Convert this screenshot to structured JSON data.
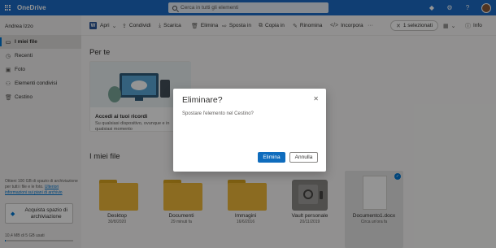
{
  "app": {
    "brand": "OneDrive"
  },
  "search": {
    "placeholder": "Cerca in tutti gli elementi"
  },
  "topbar_icons": [
    "diamond-icon",
    "gear-icon",
    "help-icon"
  ],
  "sidebar": {
    "user_name": "Andrea Izzo",
    "items": [
      {
        "label": "I miei file",
        "icon": "folder-icon",
        "active": true
      },
      {
        "label": "Recenti",
        "icon": "clock-icon"
      },
      {
        "label": "Foto",
        "icon": "photo-icon"
      },
      {
        "label": "Elementi condivisi",
        "icon": "people-icon"
      },
      {
        "label": "Cestino",
        "icon": "trash-icon"
      }
    ],
    "storage_note": "Ottieni 100 GB di spazio di archiviazione per tutti i file e le foto.",
    "storage_link": "Ulteriori informazioni sui piani di archivio",
    "buy_button": "Acquista spazio di archiviazione",
    "usage": "10,4 MB di 5 GB usati",
    "usage_fraction": 0.002
  },
  "toolbar": {
    "open": "Apri",
    "share": "Condividi",
    "download": "Scarica",
    "delete": "Elimina",
    "move": "Sposta in",
    "copy": "Copia in",
    "rename": "Rinomina",
    "embed": "Incorpora",
    "selected": "1 selezionati",
    "info": "Info"
  },
  "main": {
    "recent_title": "Per te",
    "recent_card_title": "Accedi ai tuoi ricordi",
    "recent_card_sub": "Su qualsiasi dispositivo, ovunque e in qualsiasi momento",
    "files_title": "I miei file",
    "files": [
      {
        "name": "Desktop",
        "date": "30/8/2020",
        "type": "folder",
        "count": ""
      },
      {
        "name": "Documenti",
        "date": "29 minuti fa",
        "type": "folder",
        "count": ""
      },
      {
        "name": "Immagini",
        "date": "16/6/2016",
        "type": "folder",
        "count": ""
      },
      {
        "name": "Vault personale",
        "date": "20/11/2019",
        "type": "vault"
      },
      {
        "name": "Documento1.docx",
        "date": "Circa un'ora fa",
        "type": "doc",
        "selected": true
      }
    ]
  },
  "dialog": {
    "title": "Eliminare?",
    "message": "Spostare l'elemento nel Cestino?",
    "confirm": "Elimina",
    "cancel": "Annulla"
  }
}
